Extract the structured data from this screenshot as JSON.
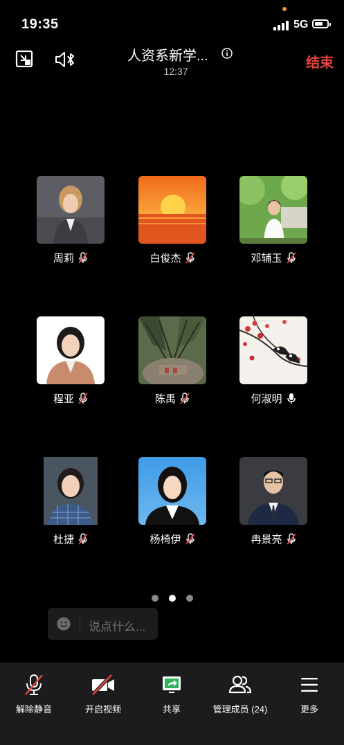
{
  "status_bar": {
    "time": "19:35",
    "network": "5G"
  },
  "header": {
    "title": "人资系新学...",
    "duration": "12:37",
    "end_label": "结束"
  },
  "participants": [
    {
      "name": "周莉",
      "mic": "muted"
    },
    {
      "name": "白俊杰",
      "mic": "muted"
    },
    {
      "name": "邓辅玉",
      "mic": "muted"
    },
    {
      "name": "程亚",
      "mic": "muted"
    },
    {
      "name": "陈禹",
      "mic": "muted"
    },
    {
      "name": "何淑明",
      "mic": "on"
    },
    {
      "name": "杜捷",
      "mic": "muted"
    },
    {
      "name": "杨椅伊",
      "mic": "muted"
    },
    {
      "name": "冉景亮",
      "mic": "muted"
    }
  ],
  "pager": {
    "total": 3,
    "active": 2
  },
  "chat": {
    "placeholder": "说点什么..."
  },
  "toolbar": {
    "unmute": "解除静音",
    "start_video": "开启视频",
    "share": "共享",
    "manage_members": "管理成员 (24)",
    "more": "更多"
  },
  "colors": {
    "end": "#e8453c",
    "share_green": "#2fb35a",
    "mute_red": "#e8453c"
  }
}
